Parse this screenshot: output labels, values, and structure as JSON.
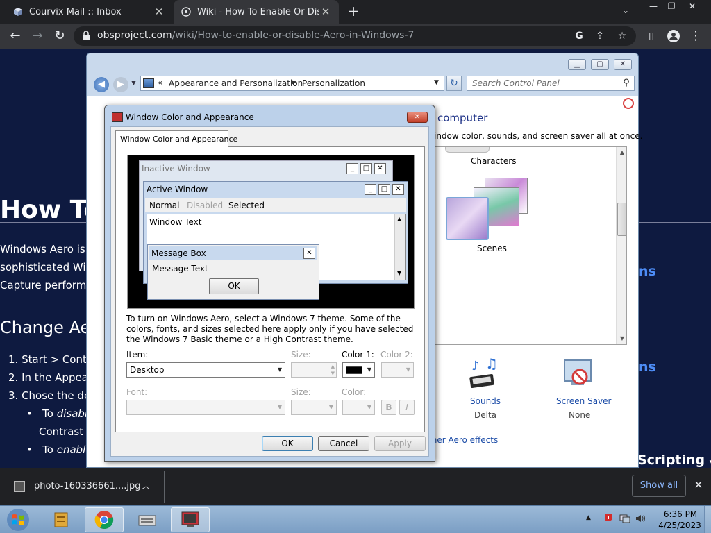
{
  "browser": {
    "tabs": [
      {
        "title": "Courvix Mail :: Inbox",
        "icon": "mail-cube-icon"
      },
      {
        "title": "Wiki - How To Enable Or Disable",
        "icon": "wiki-globe-icon"
      }
    ],
    "url_host": "obsproject.com",
    "url_path": "/wiki/How-to-enable-or-disable-Aero-in-Windows-7"
  },
  "webpage": {
    "title": "How To",
    "para_lines": [
      "Windows Aero is",
      "sophisticated Wir",
      "Capture performa"
    ],
    "subheading": "Change Ae",
    "list": [
      "1. Start > Contro",
      "2. In the Appear",
      "3. Chose the de"
    ],
    "bullets": [
      {
        "em": "disabl",
        "before": "To "
      },
      {
        "rest": "Contrast"
      },
      {
        "em": "enable",
        "before": "To "
      }
    ],
    "right_fragments": [
      "ns",
      "ns"
    ],
    "scripting": "Scripting"
  },
  "control_panel": {
    "breadcrumb_1": "Appearance and Personalization",
    "breadcrumb_2": "Personalization",
    "search_placeholder": "Search Control Panel",
    "heading": "computer",
    "subtext": "indow color, sounds, and screen saver all at once.",
    "themes": [
      {
        "label": "Characters"
      },
      {
        "label": "Scenes"
      }
    ],
    "sounds_label": "Sounds",
    "sounds_value": "Delta",
    "saver_label": "Screen Saver",
    "saver_value": "None",
    "aero_link": "ther Aero effects"
  },
  "dialog": {
    "title": "Window Color and Appearance",
    "tab": "Window Color and Appearance",
    "preview": {
      "inactive_title": "Inactive Window",
      "active_title": "Active Window",
      "menu_normal": "Normal",
      "menu_disabled": "Disabled",
      "menu_selected": "Selected",
      "window_text": "Window Text",
      "msgbox_title": "Message Box",
      "msgbox_text": "Message Text",
      "msgbox_ok": "OK"
    },
    "description": "To turn on Windows Aero, select a Windows 7 theme.  Some of the colors, fonts, and sizes selected here apply only if you have selected the Windows 7 Basic theme or a High Contrast theme.",
    "item_label": "Item:",
    "item_value": "Desktop",
    "size_label": "Size:",
    "color1_label": "Color 1:",
    "color1_value": "#000000",
    "color2_label": "Color 2:",
    "font_label": "Font:",
    "font_size_label": "Size:",
    "color_label": "Color:",
    "bold_label": "B",
    "italic_label": "I",
    "ok": "OK",
    "cancel": "Cancel",
    "apply": "Apply"
  },
  "downloads": {
    "filename": "photo-160336661....jpg",
    "show_all": "Show all"
  },
  "taskbar": {
    "time": "6:36 PM",
    "date": "4/25/2023"
  }
}
